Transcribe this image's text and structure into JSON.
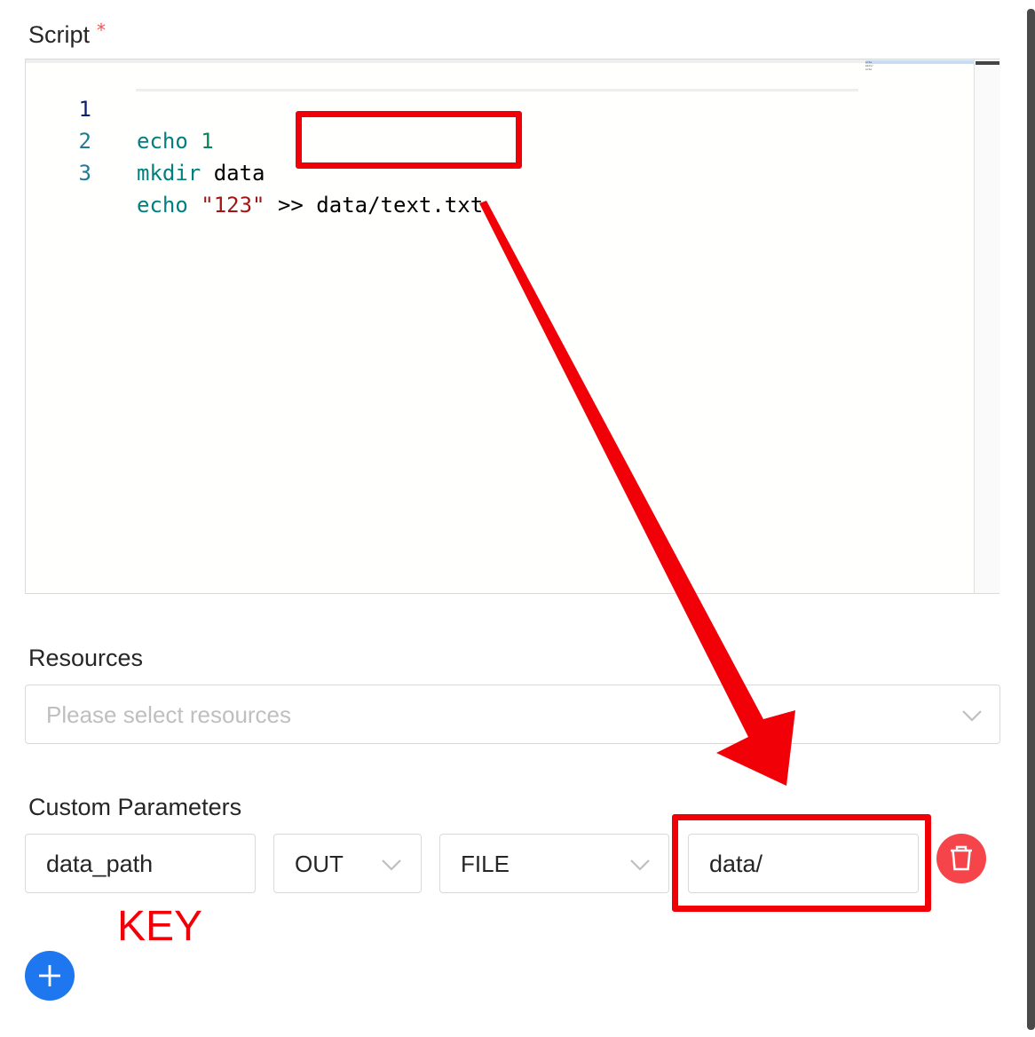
{
  "script_field": {
    "label": "Script",
    "required_marker": "*",
    "editor": {
      "lines": [
        {
          "number": "1",
          "tokens": [
            {
              "text": "echo ",
              "kind": "kw"
            },
            {
              "text": "1",
              "kind": "kw1"
            }
          ]
        },
        {
          "number": "2",
          "tokens": [
            {
              "text": "mkdir ",
              "kind": "kw"
            },
            {
              "text": "data",
              "kind": "plain"
            }
          ]
        },
        {
          "number": "3",
          "tokens": [
            {
              "text": "echo ",
              "kind": "kw"
            },
            {
              "text": "\"123\"",
              "kind": "str"
            },
            {
              "text": " >> data/text.txt",
              "kind": "plain"
            }
          ]
        }
      ]
    }
  },
  "resources_field": {
    "label": "Resources",
    "placeholder": "Please select resources"
  },
  "custom_parameters": {
    "label": "Custom Parameters",
    "rows": [
      {
        "key": "data_path",
        "direction": "OUT",
        "type": "FILE",
        "value": "data/"
      }
    ]
  },
  "annotation": {
    "key_label": "KEY",
    "color": "#f20008"
  },
  "colors": {
    "delete_button": "#f5444a",
    "add_button": "#1f77f0",
    "required": "#ff4d4f"
  },
  "icons": {
    "delete": "trash-icon",
    "add": "plus-icon",
    "dropdown": "chevron-down-icon"
  }
}
